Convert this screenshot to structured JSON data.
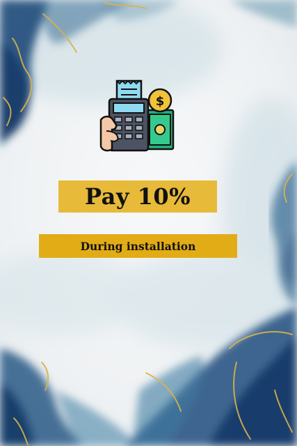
{
  "headline": "Pay 10%",
  "subline": "During installation",
  "icon": "payment-terminal-icon",
  "colors": {
    "banner_main": "#e7ba3a",
    "banner_sub": "#e2ac16",
    "ink_blue": "#1f4a7a",
    "gold": "#d8b24a"
  }
}
